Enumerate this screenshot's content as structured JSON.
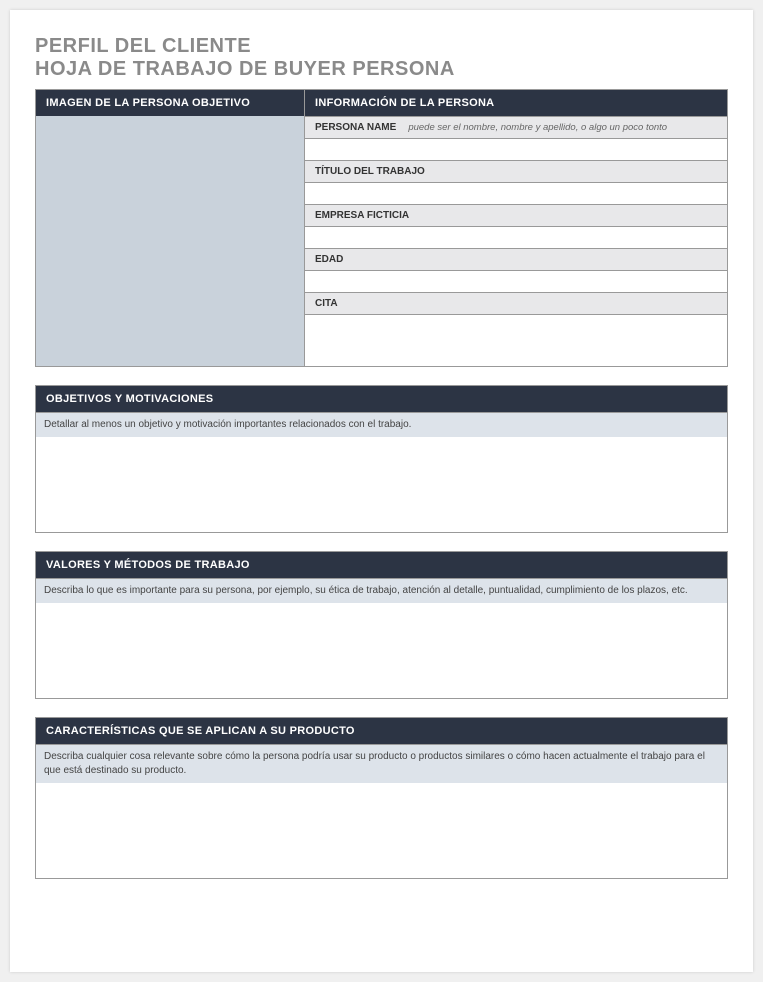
{
  "title": {
    "line1": "PERFIL DEL CLIENTE",
    "line2": "HOJA DE TRABAJO DE BUYER PERSONA"
  },
  "topSection": {
    "imageHeader": "IMAGEN DE LA PERSONA OBJETIVO",
    "infoHeader": "INFORMACIÓN DE LA PERSONA",
    "fields": {
      "personaName": {
        "label": "PERSONA NAME",
        "hint": "puede ser el nombre, nombre y apellido, o algo un poco tonto"
      },
      "jobTitle": {
        "label": "TÍTULO DEL TRABAJO"
      },
      "company": {
        "label": "EMPRESA FICTICIA"
      },
      "age": {
        "label": "EDAD"
      },
      "quote": {
        "label": "CITA"
      }
    }
  },
  "sections": {
    "objectives": {
      "header": "OBJETIVOS Y MOTIVACIONES",
      "description": "Detallar al menos un objetivo y motivación importantes relacionados con el trabajo."
    },
    "values": {
      "header": "VALORES Y MÉTODOS DE TRABAJO",
      "description": "Describa lo que es importante para su persona, por ejemplo, su ética de trabajo, atención al detalle, puntualidad, cumplimiento de los plazos, etc."
    },
    "characteristics": {
      "header": "CARACTERÍSTICAS QUE SE APLICAN A SU PRODUCTO",
      "description": "Describa cualquier cosa relevante sobre cómo la persona podría usar su producto o productos similares o cómo hacen actualmente el trabajo para el que está destinado su producto."
    }
  }
}
